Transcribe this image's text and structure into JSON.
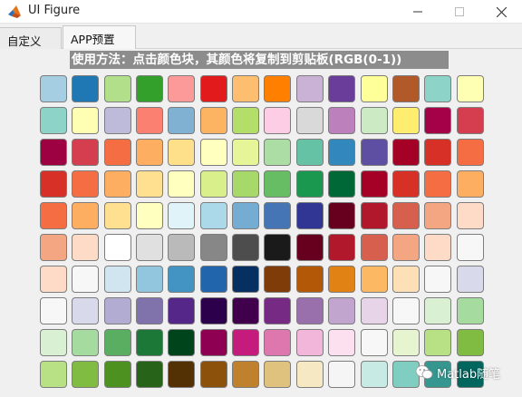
{
  "window": {
    "title": "UI Figure",
    "icon": "matlab-logo-icon",
    "minimize_icon": "minimize-icon",
    "maximize_icon": "maximize-icon",
    "close_icon": "close-icon"
  },
  "tabs": [
    {
      "label": "自定义",
      "selected": false
    },
    {
      "label": "APP预置",
      "selected": true
    }
  ],
  "instruction": "使用方法：点击颜色块，其颜色将复制到剪贴板(RGB(0-1))",
  "swatch_rows": [
    [
      "#a6cee3",
      "#1f78b4",
      "#b2df8a",
      "#33a02c",
      "#fb9a99",
      "#e31a1c",
      "#fdbf6f",
      "#ff7f00",
      "#cab2d6",
      "#6a3d9a",
      "#ffff99",
      "#b15928",
      "#8dd3c7",
      "#ffffb3"
    ],
    [
      "#8dd3c7",
      "#ffffb3",
      "#bebada",
      "#fb8072",
      "#80b1d3",
      "#fdb462",
      "#b3de69",
      "#fccde5",
      "#d9d9d9",
      "#bc80bd",
      "#ccebc5",
      "#ffed6f",
      "#a50149",
      "#d53e4f"
    ],
    [
      "#9e0142",
      "#d53e4f",
      "#f46d43",
      "#fdae61",
      "#fee08b",
      "#ffffbf",
      "#e6f598",
      "#abdda4",
      "#66c2a5",
      "#3288bd",
      "#5e4fa2",
      "#a50026",
      "#d73027",
      "#f46d43"
    ],
    [
      "#d73027",
      "#f46d43",
      "#fdae61",
      "#fee090",
      "#ffffbf",
      "#d9ef8b",
      "#a6d96a",
      "#66bd63",
      "#1a9850",
      "#006837",
      "#a50026",
      "#d73027",
      "#f46d43",
      "#fdae61"
    ],
    [
      "#f46d43",
      "#fdae61",
      "#fee090",
      "#ffffbf",
      "#e0f3f8",
      "#abd9e9",
      "#74add1",
      "#4575b4",
      "#313695",
      "#67001f",
      "#b2182b",
      "#d6604d",
      "#f4a582",
      "#fddbc7"
    ],
    [
      "#f4a582",
      "#fddbc7",
      "#ffffff",
      "#e0e0e0",
      "#bababa",
      "#878787",
      "#4d4d4d",
      "#1a1a1a",
      "#67001f",
      "#b2182b",
      "#d6604d",
      "#f4a582",
      "#fddbc7",
      "#f7f7f7"
    ],
    [
      "#fddbc7",
      "#f7f7f7",
      "#d1e5f0",
      "#92c5de",
      "#4393c3",
      "#2166ac",
      "#053061",
      "#7f3b08",
      "#b35806",
      "#e08214",
      "#fdb863",
      "#fee0b6",
      "#f7f7f7",
      "#d8daeb"
    ],
    [
      "#f7f7f7",
      "#d8daeb",
      "#b2abd2",
      "#8073ac",
      "#542788",
      "#2d004b",
      "#40004b",
      "#762a83",
      "#9970ab",
      "#c2a5cf",
      "#e7d4e8",
      "#f7f7f7",
      "#d9f0d3",
      "#a6dba0"
    ],
    [
      "#d9f0d3",
      "#a6dba0",
      "#5aae61",
      "#1b7837",
      "#00441b",
      "#8e0152",
      "#c51b7d",
      "#de77ae",
      "#f1b6da",
      "#fde0ef",
      "#f7f7f7",
      "#e6f5d0",
      "#b8e186",
      "#7fbc41"
    ],
    [
      "#b8e186",
      "#7fbc41",
      "#4d9221",
      "#276419",
      "#543005",
      "#8c510a",
      "#bf812d",
      "#dfc27d",
      "#f6e8c3",
      "#f5f5f5",
      "#c7eae5",
      "#80cdc1",
      "#35978f",
      "#01665e"
    ]
  ],
  "watermark": {
    "text": "Matlab随笔",
    "icon": "wechat-icon"
  }
}
